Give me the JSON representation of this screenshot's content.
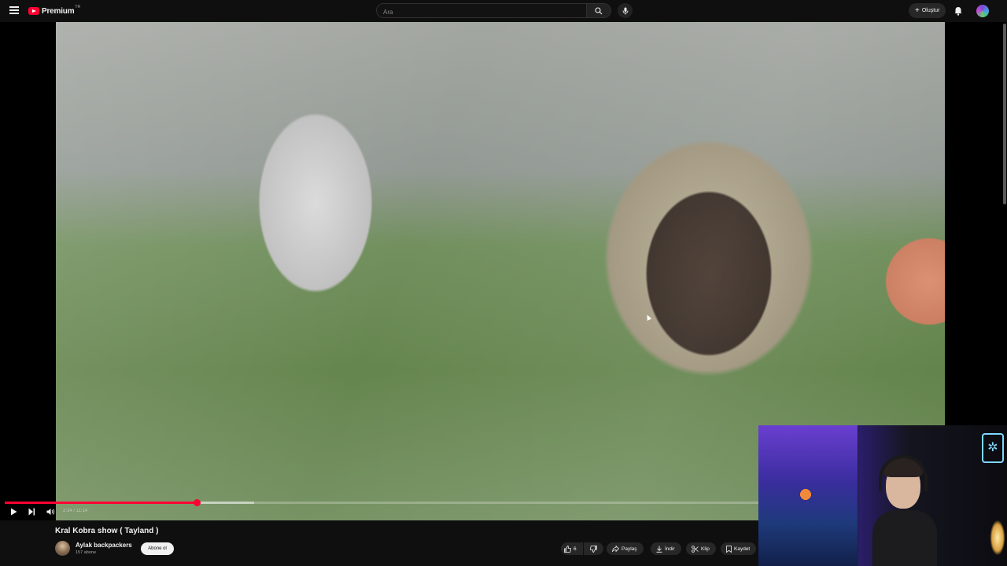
{
  "header": {
    "logo_text": "Premium",
    "logo_country": "TR",
    "search_placeholder": "Ara",
    "create_label": "Oluştur"
  },
  "player": {
    "time": "2:34 / 11:14",
    "progress": 0.254,
    "buffered": 0.33
  },
  "video": {
    "title": "Kral Kobra show ( Tayland )",
    "channel": "Aylak backpackers",
    "subscribers": "157 abone",
    "subscribe_label": "Abone ol"
  },
  "actions": {
    "likes": "6",
    "share": "Paylaş",
    "download": "İndir",
    "clip": "Klip",
    "save": "Kaydet"
  },
  "colors": {
    "accent": "#ff0033",
    "background": "#0f0f0f"
  },
  "icons": [
    "menu-icon",
    "youtube-logo-icon",
    "search-icon",
    "mic-icon",
    "plus-icon",
    "bell-icon",
    "play-icon",
    "next-icon",
    "volume-icon",
    "like-icon",
    "dislike-icon",
    "share-icon",
    "download-icon",
    "scissors-icon",
    "bookmark-icon"
  ]
}
